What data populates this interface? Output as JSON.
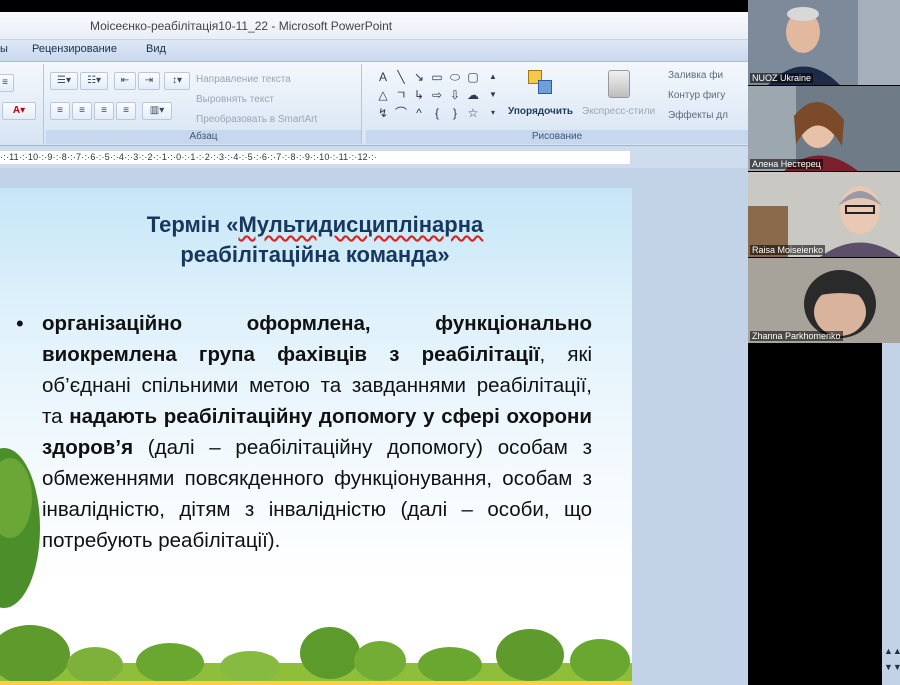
{
  "window": {
    "title": "Моісеєнко-реабілітація10-11_22 - Microsoft PowerPoint"
  },
  "ribbon_tabs": [
    {
      "label": "ы"
    },
    {
      "label": "Рецензирование"
    },
    {
      "label": "Вид"
    }
  ],
  "ribbon": {
    "paragraph": {
      "label": "Абзац",
      "text_direction": "Направление текста",
      "align_text": "Выровнять текст",
      "convert_smartart": "Преобразовать в SmartArt"
    },
    "drawing": {
      "label": "Рисование",
      "arrange": "Упорядочить",
      "quick_styles": "Экспресс-стили",
      "shape_fill": "Заливка фи",
      "shape_outline": "Контур фигу",
      "shape_effects": "Эффекты дл"
    }
  },
  "ruler": {
    "text": "·:·11·:·10·:·9·:·8·:·7·:·6·:·5·:·4·:·3·:·2·:·1·:·0·:·1·:·2·:·3·:·4·:·5·:·6·:·7·:·8·:·9·:·10·:·11·:·12·:·"
  },
  "slide": {
    "title_line1": "Термін «",
    "title_wavy": "Мультидисциплінарна",
    "title_line2": "реабілітаційна команда»",
    "bullet_symbol": "•",
    "p1_bold": "організаційно оформлена, функціонально виокремлена група фахівців з реабілітації",
    "p2": ", які об’єднані спільними метою та завданнями реабілітації, та ",
    "p3_bold": "надають реабілітаційну допомогу у сфері охорони здоров’я",
    "p4": " (далі – реабілітаційну допомогу) особам з обмеженнями повсякденного функціонування, особам з інвалідністю, дітям з інвалідністю (далі – особи, що потребують реабілітації)."
  },
  "participants": [
    {
      "name": "NUOZ Ukraine",
      "bg": "#7d8a99",
      "face": "#e2b89e",
      "suit": "#1d2a48"
    },
    {
      "name": "Алена Нестерец",
      "bg": "#6f7b86",
      "face": "#e8c2a8",
      "suit": "#7a1f2c"
    },
    {
      "name": "Raisa Moiseienko",
      "bg": "#c9c8c2",
      "face": "#e9c9b4",
      "suit": "#5d4e6a"
    },
    {
      "name": "Zhanna Parkhomenko",
      "bg": "#a7a39b",
      "face": "#d9b39c",
      "suit": "#2a2a2a"
    }
  ],
  "colors": {
    "slide_title": "#17375e",
    "ribbon_bg": "#d7e4f4",
    "workspace_bg": "#c2d3e8"
  }
}
